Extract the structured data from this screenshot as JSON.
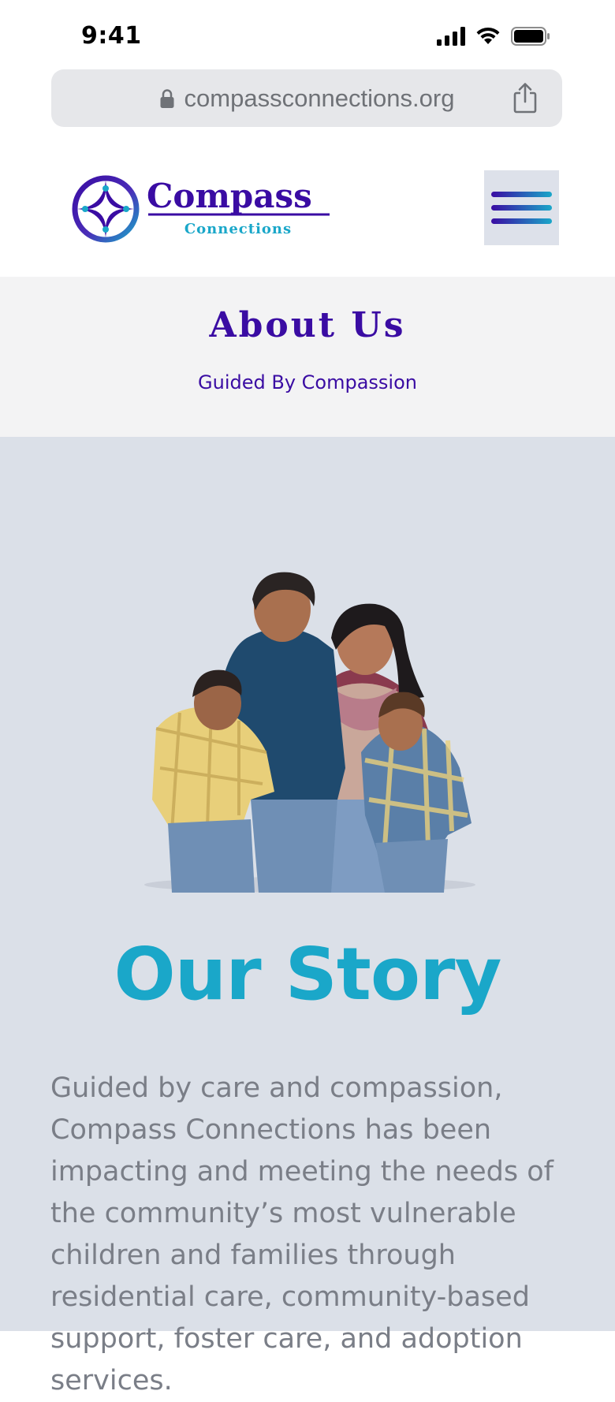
{
  "status_bar": {
    "time": "9:41"
  },
  "browser": {
    "url": "compassconnections.org",
    "lock_icon": "lock-icon",
    "share_icon": "share-icon"
  },
  "header": {
    "logo_name": "Compass",
    "logo_subname": "Connections",
    "menu_icon": "hamburger-menu-icon"
  },
  "banner": {
    "title": "About Us",
    "subtitle": "Guided By Compassion"
  },
  "story": {
    "title": "Our Story",
    "body": "Guided by care and compassion, Compass Connections has been impacting and meeting the needs of the community’s most vulnerable children and families through residential care, community-based support, foster care, and adoption services."
  },
  "colors": {
    "brand_purple": "#3a0ca3",
    "brand_teal": "#1aa7c9",
    "banner_bg": "#f3f3f4",
    "story_bg": "#dbe0e8",
    "body_text": "#7a7e87"
  }
}
